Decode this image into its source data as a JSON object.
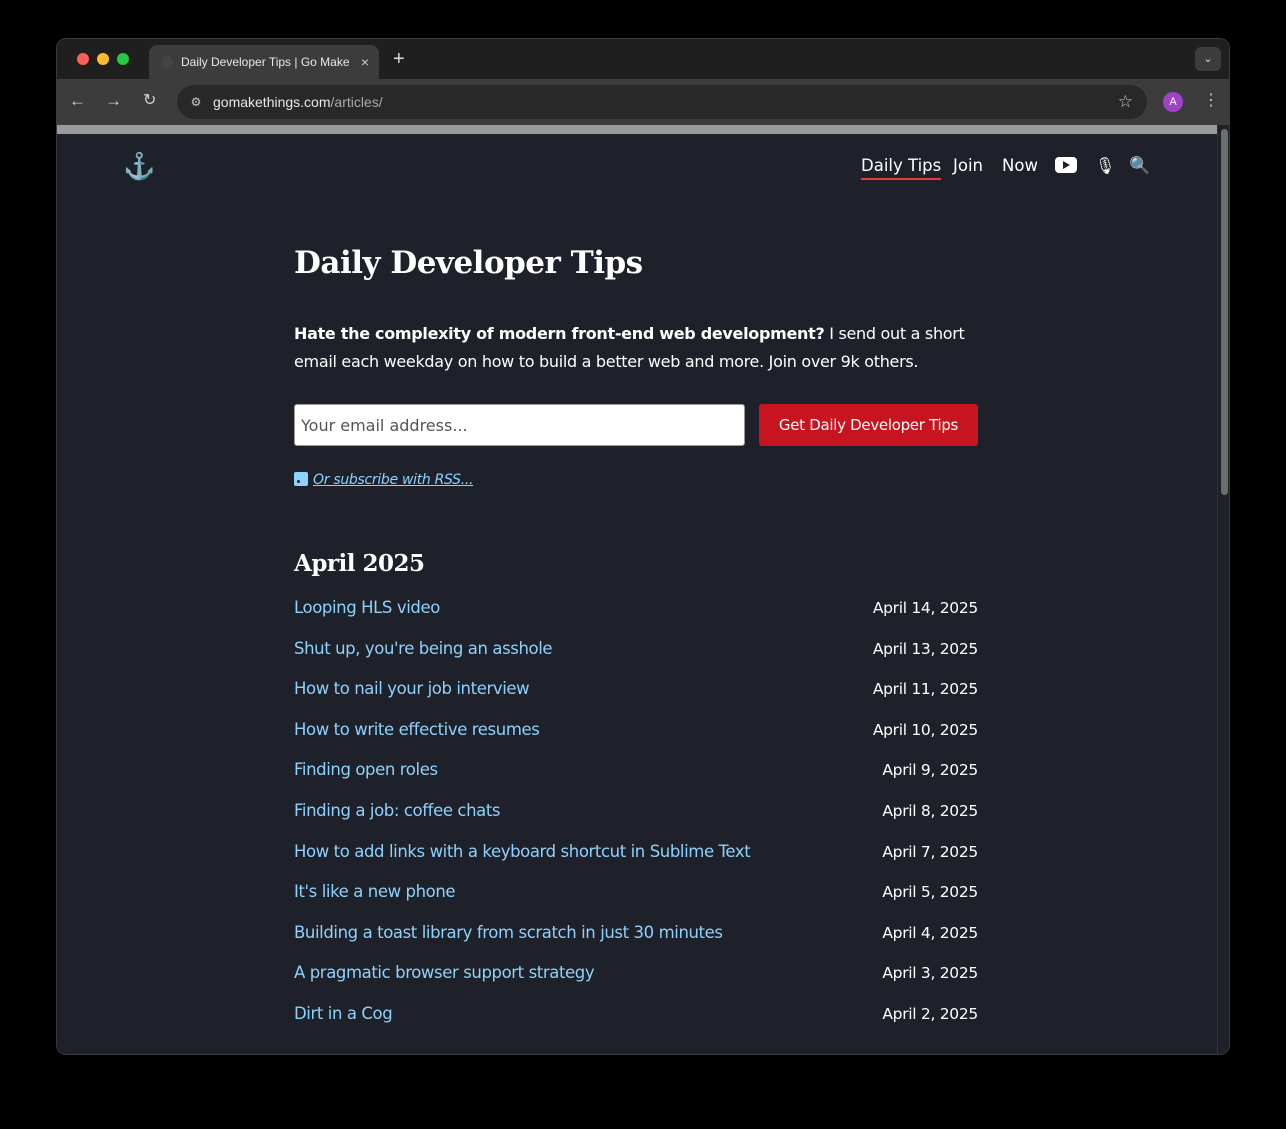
{
  "browser": {
    "tab_title": "Daily Developer Tips | Go Make Things",
    "tab_close": "×",
    "new_tab": "+",
    "tab_menu": "⌄",
    "url_domain": "gomakethings.com",
    "url_path": "/articles/",
    "back": "←",
    "forward": "→",
    "reload": "↻",
    "site_info": "⚙",
    "star": "☆",
    "avatar_initial": "A",
    "menu": "⋮"
  },
  "site": {
    "logo": "⚓",
    "nav": {
      "daily_tips": "Daily Tips",
      "join": "Join",
      "now": "Now",
      "mic": "🎙",
      "search": "🔍"
    }
  },
  "page": {
    "title": "Daily Developer Tips",
    "intro_bold": "Hate the complexity of modern front-end web development?",
    "intro_rest": " I send out a short email each weekday on how to build a better web and more. Join over 9k others.",
    "email_placeholder": "Your email address...",
    "subscribe_button": "Get Daily Developer Tips",
    "rss_text": "Or subscribe with RSS..."
  },
  "archive": {
    "month": "April 2025",
    "articles": [
      {
        "title": "Looping HLS video",
        "date": "April 14, 2025"
      },
      {
        "title": "Shut up, you're being an asshole",
        "date": "April 13, 2025"
      },
      {
        "title": "How to nail your job interview",
        "date": "April 11, 2025"
      },
      {
        "title": "How to write effective resumes",
        "date": "April 10, 2025"
      },
      {
        "title": "Finding open roles",
        "date": "April 9, 2025"
      },
      {
        "title": "Finding a job: coffee chats",
        "date": "April 8, 2025"
      },
      {
        "title": "How to add links with a keyboard shortcut in Sublime Text",
        "date": "April 7, 2025"
      },
      {
        "title": "It's like a new phone",
        "date": "April 5, 2025"
      },
      {
        "title": "Building a toast library from scratch in just 30 minutes",
        "date": "April 4, 2025"
      },
      {
        "title": "A pragmatic browser support strategy",
        "date": "April 3, 2025"
      },
      {
        "title": "Dirt in a Cog",
        "date": "April 2, 2025"
      }
    ]
  }
}
